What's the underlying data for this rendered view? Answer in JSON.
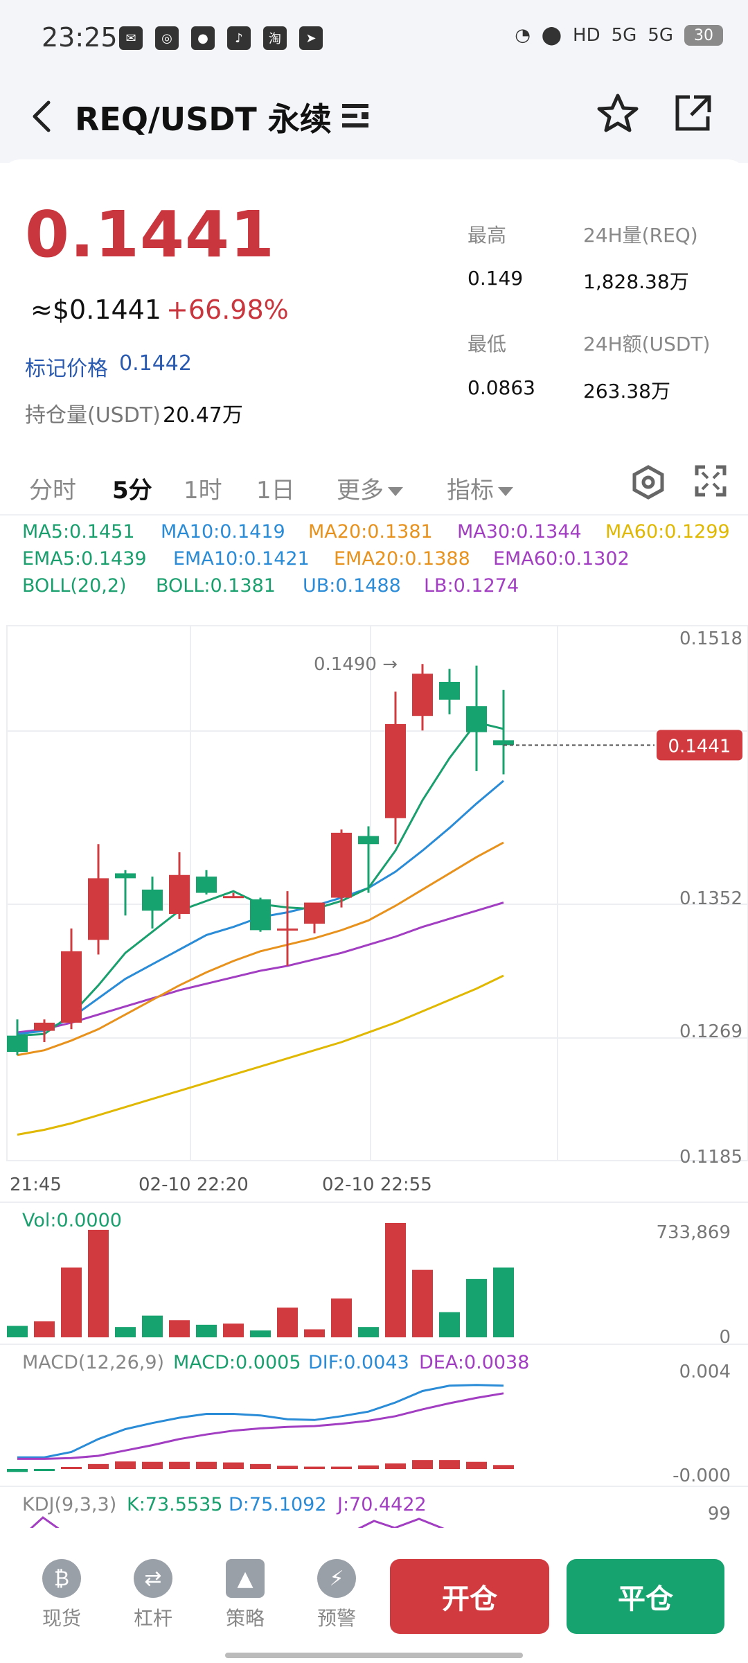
{
  "status": {
    "time": "23:25",
    "network_hd": "HD",
    "net1": "5G",
    "net2": "5G",
    "battery": "30"
  },
  "header": {
    "title": "REQ/USDT 永续"
  },
  "ticker": {
    "last_price": "0.1441",
    "usd_price": "≈$0.1441",
    "change": "+66.98%",
    "mark_label": "标记价格",
    "mark_value": "0.1442",
    "oi_label": "持仓量(USDT)",
    "oi_value": "20.47万",
    "high_label": "最高",
    "high_value": "0.149",
    "low_label": "最低",
    "low_value": "0.0863",
    "vol_label": "24H量(REQ)",
    "vol_value": "1,828.38万",
    "amt_label": "24H额(USDT)",
    "amt_value": "263.38万"
  },
  "tabs": [
    {
      "label": "分时"
    },
    {
      "label": "5分"
    },
    {
      "label": "1时"
    },
    {
      "label": "1日"
    },
    {
      "label": "更多"
    },
    {
      "label": "指标"
    }
  ],
  "indicators": {
    "ma5": "MA5:0.1451",
    "ma10": "MA10:0.1419",
    "ma20": "MA20:0.1381",
    "ma30": "MA30:0.1344",
    "ma60": "MA60:0.1299",
    "ema5": "EMA5:0.1439",
    "ema10": "EMA10:0.1421",
    "ema20": "EMA20:0.1388",
    "ema60": "EMA60:0.1302",
    "boll_name": "BOLL(20,2)",
    "boll": "BOLL:0.1381",
    "ub": "UB:0.1488",
    "lb": "LB:0.1274"
  },
  "colors": {
    "up": "#d13b40",
    "down": "#16a36f",
    "ma5": "#1a9f6e",
    "ma10": "#2a8bd6",
    "ma20": "#e8921e",
    "ma30": "#a23ec2",
    "ma60": "#e0b800"
  },
  "chart_data": {
    "type": "candlestick",
    "y_axis_labels": [
      "0.1518",
      "0.1352",
      "0.1269",
      "0.1185"
    ],
    "x_axis_labels": [
      "21:45",
      "02-10 22:20",
      "02-10 22:55"
    ],
    "ylim": [
      0.1185,
      0.1518
    ],
    "max_annotation": "0.1490 →",
    "current_price_tag": "0.1441",
    "candles": [
      {
        "o": 0.1262,
        "h": 0.1272,
        "l": 0.125,
        "c": 0.1252
      },
      {
        "o": 0.1265,
        "h": 0.1272,
        "l": 0.1258,
        "c": 0.127
      },
      {
        "o": 0.127,
        "h": 0.1328,
        "l": 0.1266,
        "c": 0.1314
      },
      {
        "o": 0.1321,
        "h": 0.138,
        "l": 0.1312,
        "c": 0.1359
      },
      {
        "o": 0.1362,
        "h": 0.1364,
        "l": 0.1336,
        "c": 0.1359
      },
      {
        "o": 0.1352,
        "h": 0.136,
        "l": 0.1328,
        "c": 0.1339
      },
      {
        "o": 0.1337,
        "h": 0.1375,
        "l": 0.1334,
        "c": 0.1361
      },
      {
        "o": 0.136,
        "h": 0.1364,
        "l": 0.1349,
        "c": 0.135
      },
      {
        "o": 0.1347,
        "h": 0.135,
        "l": 0.1347,
        "c": 0.1348
      },
      {
        "o": 0.1346,
        "h": 0.1347,
        "l": 0.1326,
        "c": 0.1327
      },
      {
        "o": 0.1328,
        "h": 0.1351,
        "l": 0.1305,
        "c": 0.1328
      },
      {
        "o": 0.1331,
        "h": 0.134,
        "l": 0.1325,
        "c": 0.1344
      },
      {
        "o": 0.1347,
        "h": 0.1389,
        "l": 0.1341,
        "c": 0.1387
      },
      {
        "o": 0.1385,
        "h": 0.1391,
        "l": 0.135,
        "c": 0.138
      },
      {
        "o": 0.1396,
        "h": 0.1474,
        "l": 0.138,
        "c": 0.1454
      },
      {
        "o": 0.1459,
        "h": 0.1491,
        "l": 0.145,
        "c": 0.1485
      },
      {
        "o": 0.148,
        "h": 0.1488,
        "l": 0.146,
        "c": 0.1469
      },
      {
        "o": 0.1465,
        "h": 0.149,
        "l": 0.1425,
        "c": 0.1449
      },
      {
        "o": 0.1444,
        "h": 0.1475,
        "l": 0.1423,
        "c": 0.1441
      }
    ],
    "ma_lines": {
      "ma5": [
        0.1262,
        0.1263,
        0.1275,
        0.1293,
        0.1313,
        0.1326,
        0.1339,
        0.1345,
        0.1351,
        0.1343,
        0.1341,
        0.134,
        0.1345,
        0.1353,
        0.1376,
        0.1407,
        0.1433,
        0.1455,
        0.1451
      ],
      "ma10": [
        0.1263,
        0.1265,
        0.1273,
        0.1285,
        0.1297,
        0.1306,
        0.1315,
        0.1324,
        0.1329,
        0.1335,
        0.1338,
        0.1342,
        0.1347,
        0.1353,
        0.1363,
        0.1376,
        0.139,
        0.1405,
        0.1419
      ],
      "ma20": [
        0.125,
        0.1253,
        0.1259,
        0.1266,
        0.1275,
        0.1284,
        0.1293,
        0.1301,
        0.1308,
        0.1314,
        0.1318,
        0.1322,
        0.1327,
        0.1333,
        0.1342,
        0.1352,
        0.1362,
        0.1372,
        0.1381
      ],
      "ma30": [
        0.1264,
        0.1266,
        0.127,
        0.1275,
        0.128,
        0.1285,
        0.129,
        0.1294,
        0.1298,
        0.1302,
        0.1305,
        0.1309,
        0.1313,
        0.1318,
        0.1323,
        0.1329,
        0.1334,
        0.1339,
        0.1344
      ],
      "ma60": [
        0.1201,
        0.1204,
        0.1208,
        0.1213,
        0.1218,
        0.1223,
        0.1228,
        0.1233,
        0.1238,
        0.1243,
        0.1248,
        0.1253,
        0.1258,
        0.1264,
        0.127,
        0.1277,
        0.1284,
        0.1291,
        0.1299
      ]
    },
    "volume": {
      "label": "Vol:0.0000",
      "axis_max": "733,869",
      "axis_min": "0",
      "values": [
        0.1,
        0.14,
        0.61,
        0.94,
        0.09,
        0.19,
        0.15,
        0.11,
        0.12,
        0.06,
        0.26,
        0.07,
        0.34,
        0.09,
        1.0,
        0.59,
        0.22,
        0.51,
        0.61
      ]
    },
    "macd": {
      "name": "MACD(12,26,9)",
      "macd": "MACD:0.0005",
      "dif": "DIF:0.0043",
      "dea": "DEA:0.0038",
      "axis_max": "0.004",
      "axis_min": "-0.000",
      "hist": [
        -0.15,
        -0.1,
        0.04,
        0.25,
        0.38,
        0.36,
        0.36,
        0.36,
        0.33,
        0.25,
        0.16,
        0.12,
        0.12,
        0.18,
        0.28,
        0.45,
        0.45,
        0.36,
        0.2
      ],
      "dif_line": [
        0.08,
        0.08,
        0.15,
        0.32,
        0.45,
        0.53,
        0.6,
        0.65,
        0.65,
        0.63,
        0.58,
        0.57,
        0.62,
        0.68,
        0.8,
        0.95,
        1.02,
        1.03,
        1.02
      ],
      "dea_line": [
        0.06,
        0.06,
        0.07,
        0.1,
        0.17,
        0.24,
        0.32,
        0.38,
        0.43,
        0.46,
        0.48,
        0.49,
        0.52,
        0.56,
        0.62,
        0.71,
        0.79,
        0.86,
        0.92
      ]
    },
    "kdj": {
      "name": "KDJ(9,3,3)",
      "k": "K:73.5535",
      "d": "D:75.1092",
      "j": "J:70.4422",
      "axis_max": "99"
    }
  },
  "bottom_nav": [
    {
      "label": "现货"
    },
    {
      "label": "杠杆"
    },
    {
      "label": "策略"
    },
    {
      "label": "预警"
    }
  ],
  "actions": {
    "open": "开仓",
    "close": "平仓"
  }
}
